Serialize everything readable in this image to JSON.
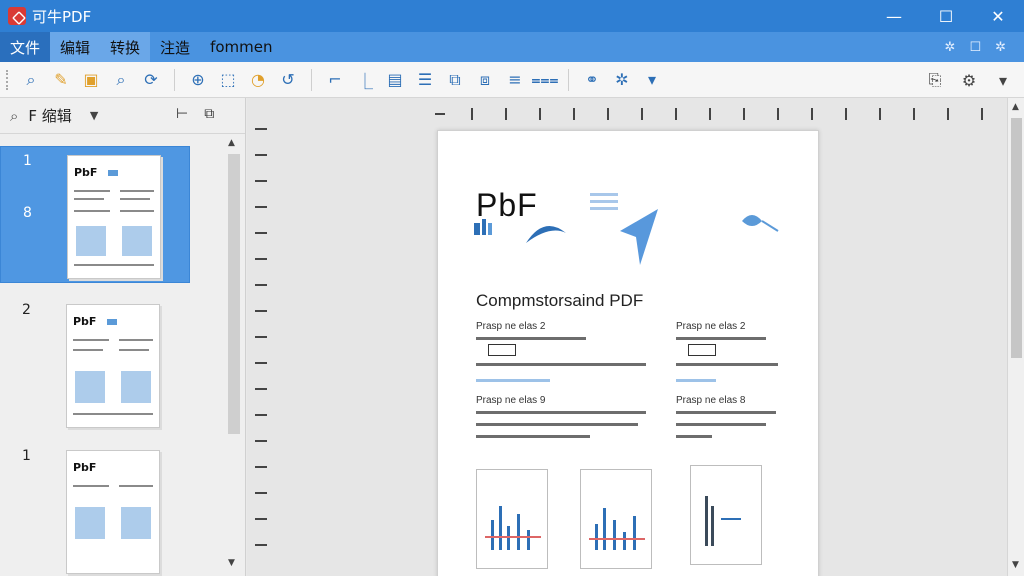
{
  "window": {
    "title": "可牛PDF",
    "controls": {
      "minimize": "—",
      "maximize": "☐",
      "close": "✕"
    }
  },
  "menu": {
    "items": [
      {
        "label": "文件",
        "state": "active"
      },
      {
        "label": "编辑",
        "state": "hover"
      },
      {
        "label": "转换",
        "state": "hover"
      },
      {
        "label": "注造",
        "state": "plain"
      },
      {
        "label": "fommen",
        "state": "plain"
      }
    ],
    "right_icons": [
      "✲",
      "☐",
      "✲"
    ]
  },
  "toolbar": {
    "left_icons": [
      "search-icon",
      "highlighter-icon",
      "file-lock-icon",
      "find-page-icon",
      "refresh-icon"
    ],
    "mid_icons": [
      "zoom-icon",
      "select-icon",
      "shapes-icon",
      "rotate-icon"
    ],
    "right_icons": [
      "crop-icon",
      "line-icon",
      "page-icon",
      "list-icon",
      "split-icon",
      "merge-icon",
      "align-icon",
      "columns-icon"
    ],
    "tool_icons": [
      "link-icon",
      "sparkle-icon",
      "dropdown-icon"
    ],
    "far_right_icons": [
      "export-icon",
      "settings-icon",
      "dropdown-icon"
    ]
  },
  "sidebar": {
    "search_icon": "🔍",
    "title": "F 缩辑",
    "thumbnails": [
      {
        "number": "1",
        "sub_number": "8",
        "selected": true
      },
      {
        "number": "2",
        "sub_number": "",
        "selected": false
      },
      {
        "number": "1",
        "sub_number": "",
        "selected": false
      }
    ],
    "thumb_title": "PbF"
  },
  "document": {
    "title": "PbF",
    "heading": "Compmstorsaind PDF",
    "sections": [
      {
        "label": "Prasp ne elas 2"
      },
      {
        "label": "Prasp ne elas 2"
      },
      {
        "label": "Prasp ne elas 9"
      },
      {
        "label": "Prasp ne elas 8"
      }
    ]
  },
  "colors": {
    "titlebar": "#2f7fd3",
    "menubar": "#4a93e0",
    "selected": "#4f97e2",
    "accent": "#2d6fb6"
  }
}
